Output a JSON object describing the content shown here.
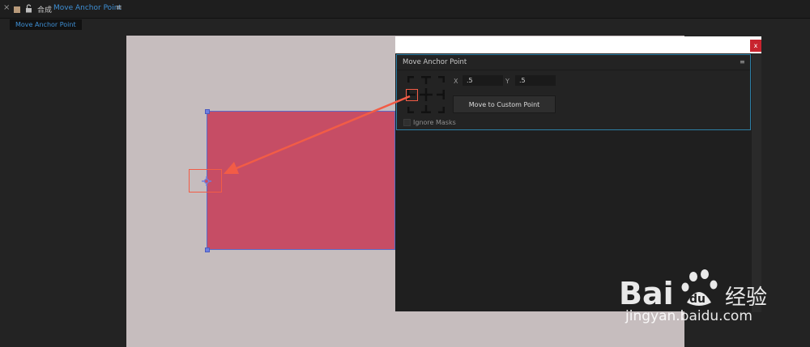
{
  "tab": {
    "close_glyph": "×",
    "prefix": "合成",
    "name": "Move Anchor Point",
    "menu_glyph": "≡"
  },
  "breadcrumb": {
    "label": "Move Anchor Point"
  },
  "colors": {
    "accent": "#3e8fd4",
    "canvas_bg": "#c6bdbe",
    "layer_fill": "#c64d65",
    "selection": "#6e7fe0",
    "annotation": "#f25c46",
    "panel_border": "#2d7fa6",
    "close_red": "#c8242f"
  },
  "floating_window": {
    "close_label": "x"
  },
  "panel": {
    "title": "Move Anchor Point",
    "menu_glyph": "≡",
    "x_label": "X",
    "x_value": ".5",
    "y_label": "Y",
    "y_value": ".5",
    "move_button": "Move to Custom Point",
    "ignore_masks_label": "Ignore Masks",
    "ignore_masks_checked": false
  },
  "watermark": {
    "url": "jingyan.baidu.com"
  }
}
